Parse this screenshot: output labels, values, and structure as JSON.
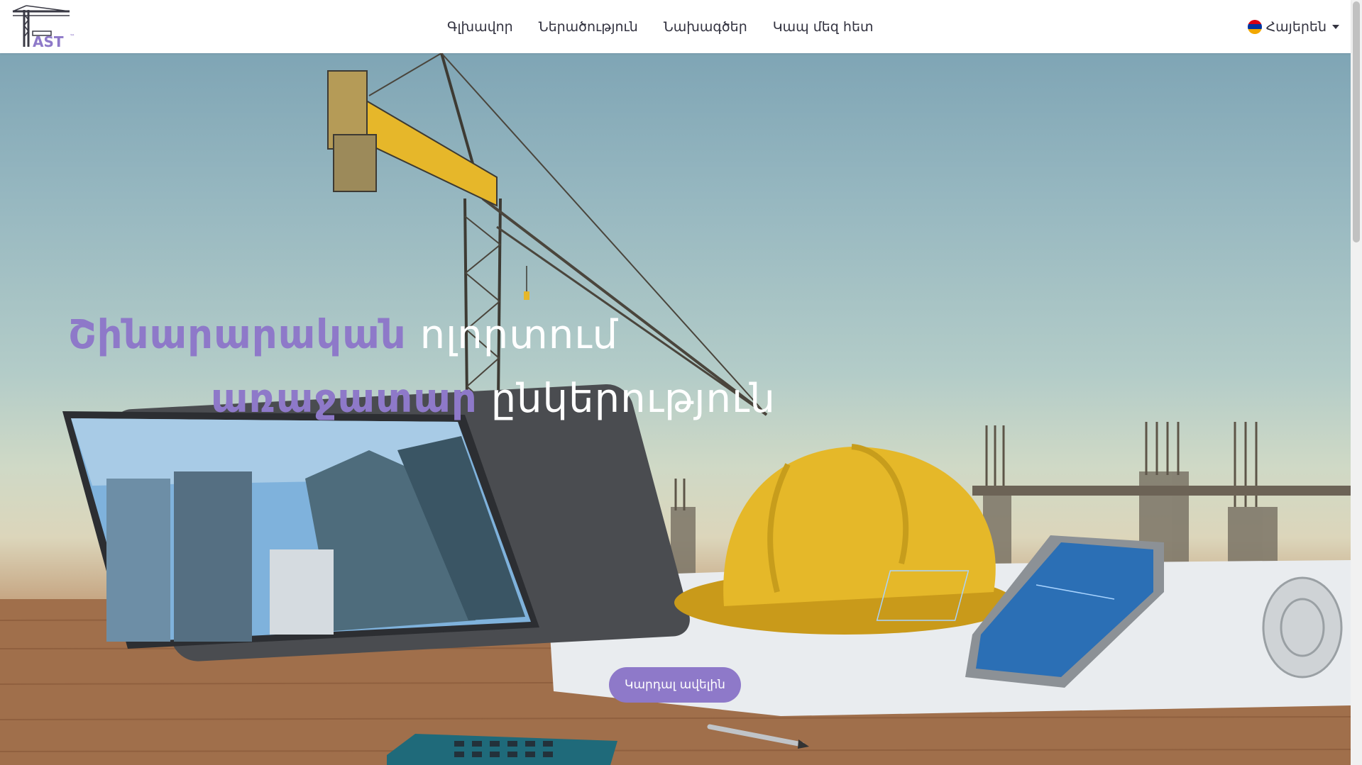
{
  "nav": {
    "links": [
      "Գլխավոր",
      "Ներածություն",
      "Նախագծեր",
      "Կապ մեզ հետ"
    ],
    "language": "Հայերեն"
  },
  "logo": {
    "text": "AST",
    "trademark": "™"
  },
  "hero": {
    "line1_accent": "Շինարարական",
    "line1_rest": "ոլորտում",
    "line2_accent": "առաջատար",
    "line2_rest": "ընկերություն",
    "cta_label": "Կարդալ ավելին"
  },
  "colors": {
    "accent": "#8e79c9",
    "nav_text": "#333340"
  },
  "icons": {
    "flag": "armenia-flag-icon",
    "caret": "chevron-down-icon"
  }
}
